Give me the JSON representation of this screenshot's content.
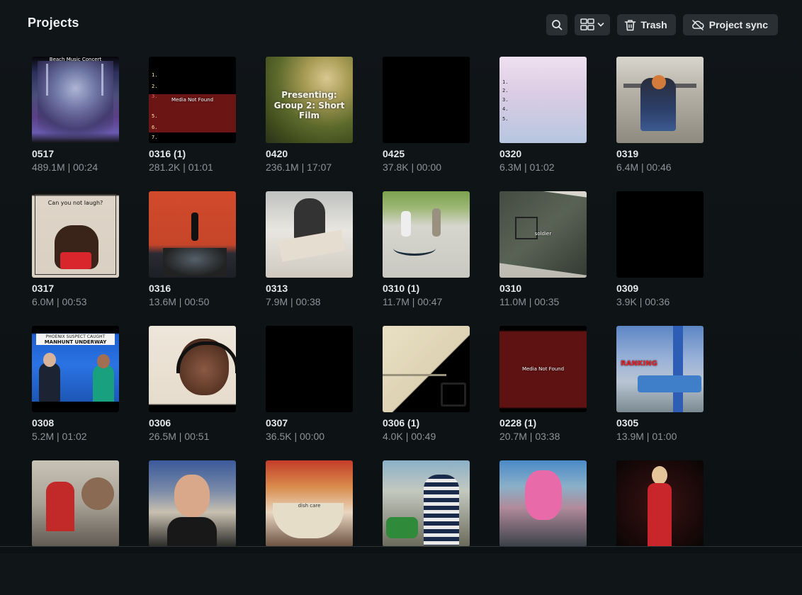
{
  "header": {
    "title": "Projects",
    "trash_label": "Trash",
    "sync_label": "Project sync"
  },
  "thumb_text": {
    "t0": "Beach Music Concert",
    "t1": "Media Not Found",
    "t2a": "Presenting:",
    "t2b": "Group 2: Short Film",
    "t6": "Can you not laugh?",
    "t15": "soldier",
    "t18a": "PHOENIX SUSPECT CAUGHT",
    "t18b": "MANHUNT UNDERWAY",
    "t22": "Media Not Found",
    "t23": "RANKING",
    "t26": "dish care"
  },
  "projects": [
    {
      "name": "0517",
      "meta": "489.1M | 00:24"
    },
    {
      "name": "0316 (1)",
      "meta": "281.2K | 01:01"
    },
    {
      "name": "0420",
      "meta": "236.1M | 17:07"
    },
    {
      "name": "0425",
      "meta": "37.8K | 00:00"
    },
    {
      "name": "0320",
      "meta": "6.3M | 01:02"
    },
    {
      "name": "0319",
      "meta": "6.4M | 00:46"
    },
    {
      "name": "0317",
      "meta": "6.0M | 00:53"
    },
    {
      "name": "0316",
      "meta": "13.6M | 00:50"
    },
    {
      "name": "0313",
      "meta": "7.9M | 00:38"
    },
    {
      "name": "0310 (1)",
      "meta": "11.7M | 00:47"
    },
    {
      "name": "0310",
      "meta": "11.0M | 00:35"
    },
    {
      "name": "0309",
      "meta": "3.9K | 00:36"
    },
    {
      "name": "0308",
      "meta": "5.2M | 01:02"
    },
    {
      "name": "0306",
      "meta": "26.5M | 00:51"
    },
    {
      "name": "0307",
      "meta": "36.5K | 00:00"
    },
    {
      "name": "0306 (1)",
      "meta": "4.0K | 00:49"
    },
    {
      "name": "0228 (1)",
      "meta": "20.7M | 03:38"
    },
    {
      "name": "0305",
      "meta": "13.9M | 01:00"
    },
    {
      "name": "",
      "meta": ""
    },
    {
      "name": "",
      "meta": ""
    },
    {
      "name": "",
      "meta": ""
    },
    {
      "name": "",
      "meta": ""
    },
    {
      "name": "",
      "meta": ""
    },
    {
      "name": "",
      "meta": ""
    }
  ],
  "icons": {
    "search": "search-icon",
    "view": "grid-view-icon",
    "dropdown": "chevron-down-icon",
    "trash": "trash-icon",
    "sync": "cloud-sync-icon"
  },
  "colors": {
    "background": "#0e1316",
    "button_bg": "#2a2f33",
    "meta_text": "#8d9396"
  }
}
